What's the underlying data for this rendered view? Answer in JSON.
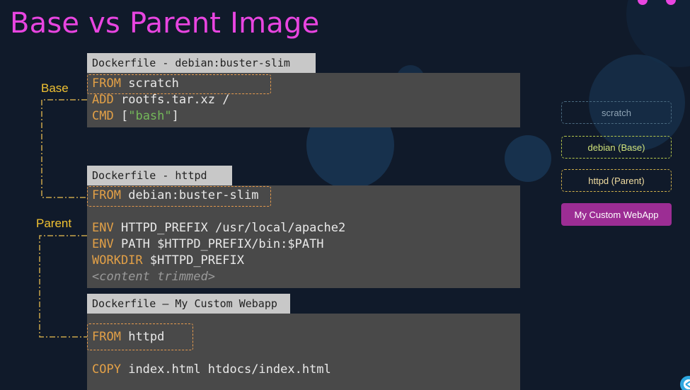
{
  "title": "Base vs Parent Image",
  "labels": {
    "base": "Base",
    "parent": "Parent"
  },
  "debian": {
    "tab": "Dockerfile - debian:buster-slim",
    "line1": {
      "kw": "FROM",
      "arg": "scratch"
    },
    "line2": {
      "kw": "ADD",
      "arg": "rootfs.tar.xz /"
    },
    "line3": {
      "kw": "CMD",
      "open": "[",
      "str": "\"bash\"",
      "close": "]"
    }
  },
  "httpd": {
    "tab": "Dockerfile - httpd",
    "line1": {
      "kw": "FROM",
      "arg": "debian:buster-slim"
    },
    "line2": {
      "kw": "ENV",
      "arg": "HTTPD_PREFIX /usr/local/apache2"
    },
    "line3": {
      "kw": "ENV",
      "arg": "PATH $HTTPD_PREFIX/bin:$PATH"
    },
    "line4": {
      "kw": "WORKDIR",
      "arg": "$HTTPD_PREFIX"
    },
    "comment": "<content trimmed>"
  },
  "webapp": {
    "tab": "Dockerfile – My Custom Webapp",
    "line1": {
      "kw": "FROM",
      "arg": "httpd"
    },
    "line2": {
      "kw": "COPY",
      "arg": "index.html htdocs/index.html"
    }
  },
  "legend": {
    "scratch": "scratch",
    "base": "debian (Base)",
    "parent": "httpd (Parent)",
    "custom": "My Custom WebApp"
  },
  "colors": {
    "background": "#101a2a",
    "title": "#e845e0",
    "keyword": "#e2a047",
    "string": "#74b95a",
    "label": "#f1c232",
    "custom_badge": "#9c2d94"
  }
}
